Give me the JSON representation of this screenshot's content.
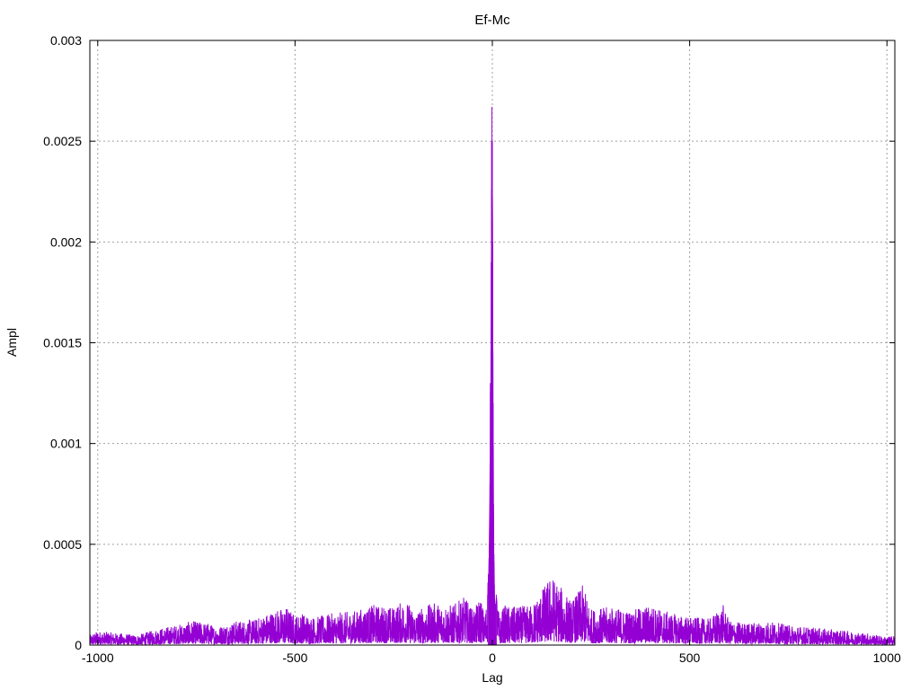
{
  "chart_data": {
    "type": "line",
    "title": "Ef-Mc",
    "xlabel": "Lag",
    "ylabel": "Ampl",
    "xlim": [
      -1020,
      1020
    ],
    "ylim": [
      0,
      0.003
    ],
    "xticks": [
      -1000,
      -500,
      0,
      500,
      1000
    ],
    "xtick_labels": [
      "-1000",
      "-500",
      "0",
      "500",
      "1000"
    ],
    "yticks": [
      0,
      0.0005,
      0.001,
      0.0015,
      0.002,
      0.0025,
      0.003
    ],
    "ytick_labels": [
      "0",
      "0.0005",
      "0.001",
      "0.0015",
      "0.002",
      "0.0025",
      "0.003"
    ],
    "grid": true,
    "legend": "none",
    "series": [
      {
        "color": "#9400D3",
        "x": [
          -1020,
          -1000,
          -950,
          -900,
          -850,
          -800,
          -760,
          -720,
          -700,
          -650,
          -600,
          -560,
          -520,
          -500,
          -480,
          -450,
          -400,
          -350,
          -300,
          -250,
          -220,
          -200,
          -150,
          -100,
          -70,
          -50,
          -40,
          -30,
          -20,
          -15,
          -10,
          -8,
          -6,
          -5,
          -4,
          -3,
          -2,
          -1,
          0,
          1,
          2,
          3,
          4,
          5,
          6,
          8,
          10,
          15,
          20,
          30,
          50,
          100,
          150,
          200,
          230,
          250,
          300,
          350,
          400,
          450,
          500,
          550,
          585,
          600,
          650,
          700,
          750,
          800,
          850,
          900,
          950,
          1000,
          1020
        ],
        "y": [
          5e-05,
          7e-05,
          6e-05,
          5e-05,
          8e-05,
          0.0001,
          0.00012,
          0.00011,
          9e-05,
          0.00012,
          0.00013,
          0.00017,
          0.00019,
          0.00015,
          0.00016,
          0.00014,
          0.00016,
          0.00017,
          0.0002,
          0.00019,
          0.00023,
          0.00017,
          0.00021,
          0.0002,
          0.00024,
          0.00018,
          0.0002,
          0.00025,
          0.00015,
          0.00021,
          0.00035,
          0.0005,
          0.0008,
          0.0013,
          0.0011,
          0.0019,
          0.0025,
          0.00267,
          0.0025,
          0.002,
          0.0012,
          0.0007,
          0.00045,
          0.0003,
          0.00022,
          0.0002,
          0.00025,
          0.00018,
          0.00015,
          0.0002,
          0.00019,
          0.0002,
          0.00035,
          0.00022,
          0.0003,
          0.00018,
          0.00019,
          0.00017,
          0.0002,
          0.00016,
          0.00014,
          0.00013,
          0.0002,
          0.00012,
          0.00011,
          0.00012,
          0.0001,
          9e-05,
          8e-05,
          7e-05,
          6e-05,
          4e-05,
          5e-05
        ]
      }
    ]
  }
}
